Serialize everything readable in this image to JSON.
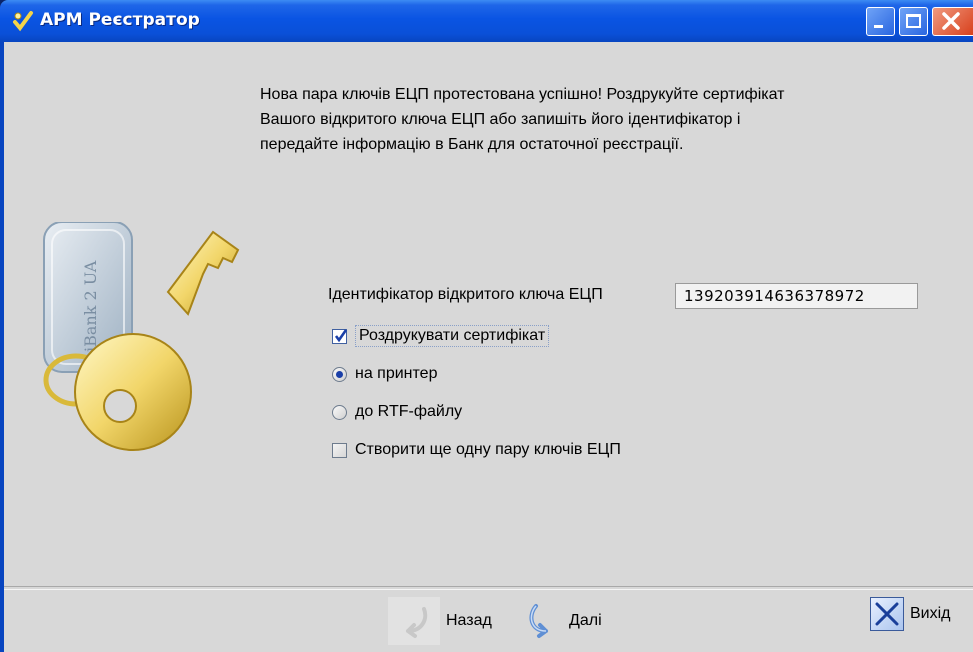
{
  "window": {
    "title": "АРМ Реєстратор",
    "icons": {
      "app": "key-check-icon",
      "minimize": "minimize-icon",
      "maximize": "maximize-icon",
      "close": "close-icon"
    }
  },
  "message": {
    "lines": [
      "Нова пара ключів ЕЦП протестована успішно! Роздрукуйте сертифікат",
      "Вашого відкритого ключа ЕЦП або запишіть його ідентифікатор і",
      "передайте інформацію в Банк для остаточної реєстрації."
    ]
  },
  "illustration": {
    "token_text": "iBank 2 UA",
    "icon": "key-illustration-icon"
  },
  "form": {
    "key_id_label": "Ідентифікатор відкритого ключа ЕЦП",
    "key_id_value": "139203914636378972",
    "print_certificate_label": "Роздрукувати сертифікат",
    "print_certificate_checked": true,
    "to_printer_label": "на принтер",
    "to_printer_selected": true,
    "to_rtf_label": "до RTF-файлу",
    "to_rtf_selected": false,
    "create_another_label": "Створити ще одну пару ключів ЕЦП",
    "create_another_checked": false
  },
  "buttons": {
    "back_label": "Назад",
    "back_enabled": false,
    "next_label": "Далі",
    "exit_label": "Вихід",
    "icons": {
      "back": "back-arrow-icon",
      "next": "next-arrow-icon",
      "exit": "exit-x-icon"
    }
  },
  "colors": {
    "titlebar": "#0a54e3",
    "client_bg": "#d8d8d8",
    "close_button": "#d8401c"
  }
}
